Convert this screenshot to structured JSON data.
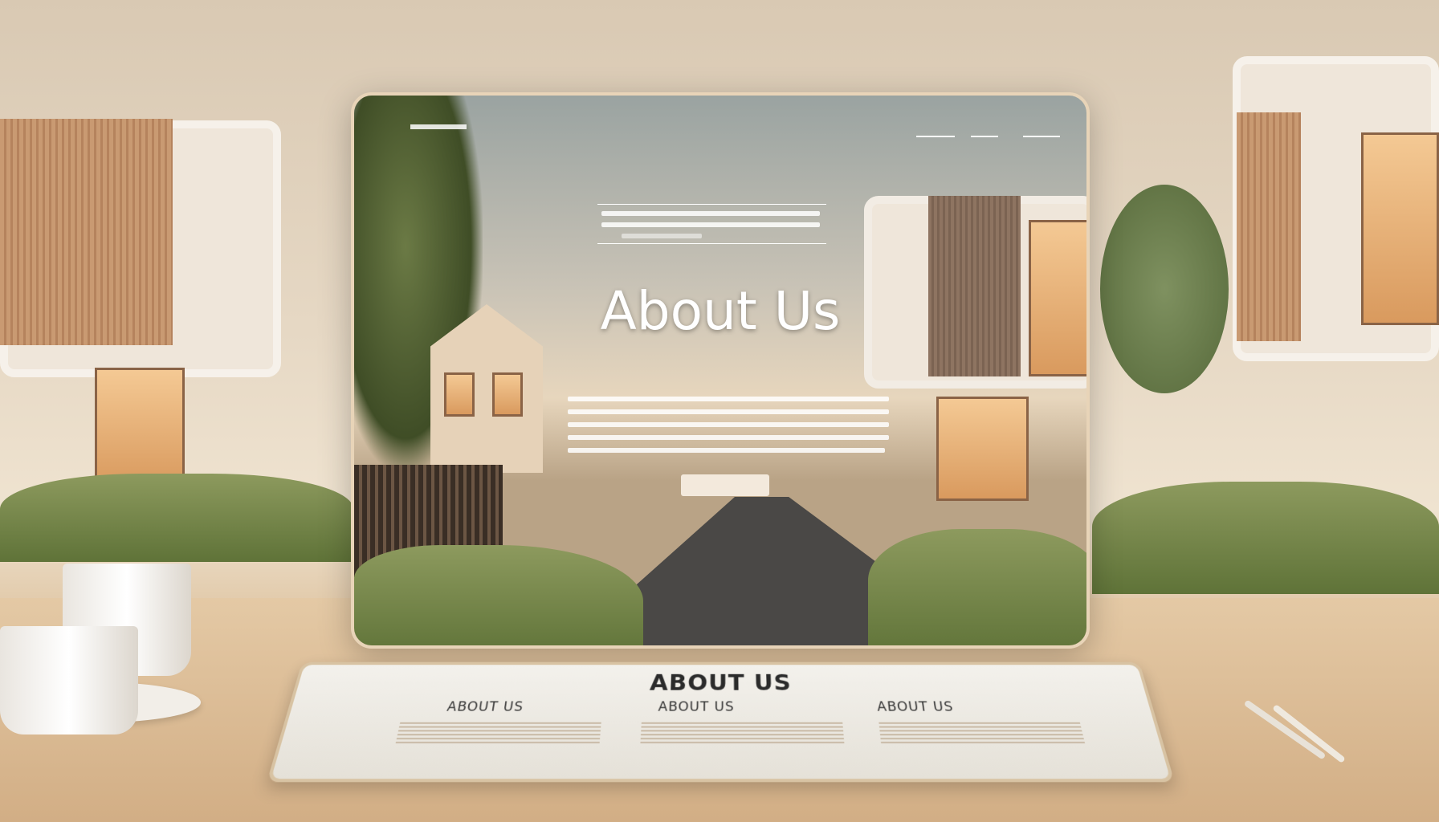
{
  "website": {
    "nav": {
      "logo": "",
      "items": [
        "",
        "",
        ""
      ]
    },
    "hero_title": "About Us",
    "cta_label": ""
  },
  "tablet": {
    "heading": "ABOUT US",
    "columns": [
      "ABOUT US",
      "ABOUT US",
      "ABOUT US"
    ]
  },
  "colors": {
    "background": "#e6d8c4",
    "desk": "#d9b68d",
    "title_text": "#ffffff",
    "wood_accent": "#c99a72"
  }
}
